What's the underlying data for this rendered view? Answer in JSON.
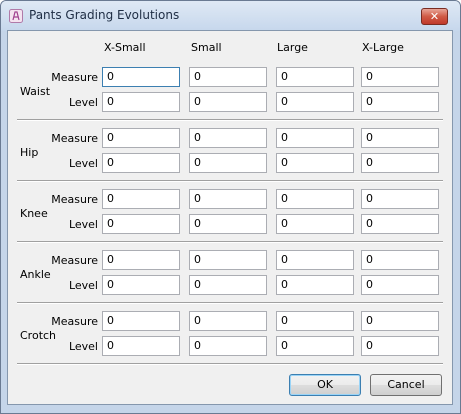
{
  "window": {
    "title": "Pants Grading Evolutions",
    "app_icon": "app-icon",
    "close_icon": "close-icon",
    "close_glyph": "✕"
  },
  "columns": [
    "X-Small",
    "Small",
    "Large",
    "X-Large"
  ],
  "groups": [
    {
      "label": "Waist",
      "rows": [
        {
          "label": "Measure",
          "values": [
            "0",
            "0",
            "0",
            "0"
          ]
        },
        {
          "label": "Level",
          "values": [
            "0",
            "0",
            "0",
            "0"
          ]
        }
      ]
    },
    {
      "label": "Hip",
      "rows": [
        {
          "label": "Measure",
          "values": [
            "0",
            "0",
            "0",
            "0"
          ]
        },
        {
          "label": "Level",
          "values": [
            "0",
            "0",
            "0",
            "0"
          ]
        }
      ]
    },
    {
      "label": "Knee",
      "rows": [
        {
          "label": "Measure",
          "values": [
            "0",
            "0",
            "0",
            "0"
          ]
        },
        {
          "label": "Level",
          "values": [
            "0",
            "0",
            "0",
            "0"
          ]
        }
      ]
    },
    {
      "label": "Ankle",
      "rows": [
        {
          "label": "Measure",
          "values": [
            "0",
            "0",
            "0",
            "0"
          ]
        },
        {
          "label": "Level",
          "values": [
            "0",
            "0",
            "0",
            "0"
          ]
        }
      ]
    },
    {
      "label": "Crotch",
      "rows": [
        {
          "label": "Measure",
          "values": [
            "0",
            "0",
            "0",
            "0"
          ]
        },
        {
          "label": "Level",
          "values": [
            "0",
            "0",
            "0",
            "0"
          ]
        }
      ]
    }
  ],
  "buttons": {
    "ok": "OK",
    "cancel": "Cancel"
  }
}
